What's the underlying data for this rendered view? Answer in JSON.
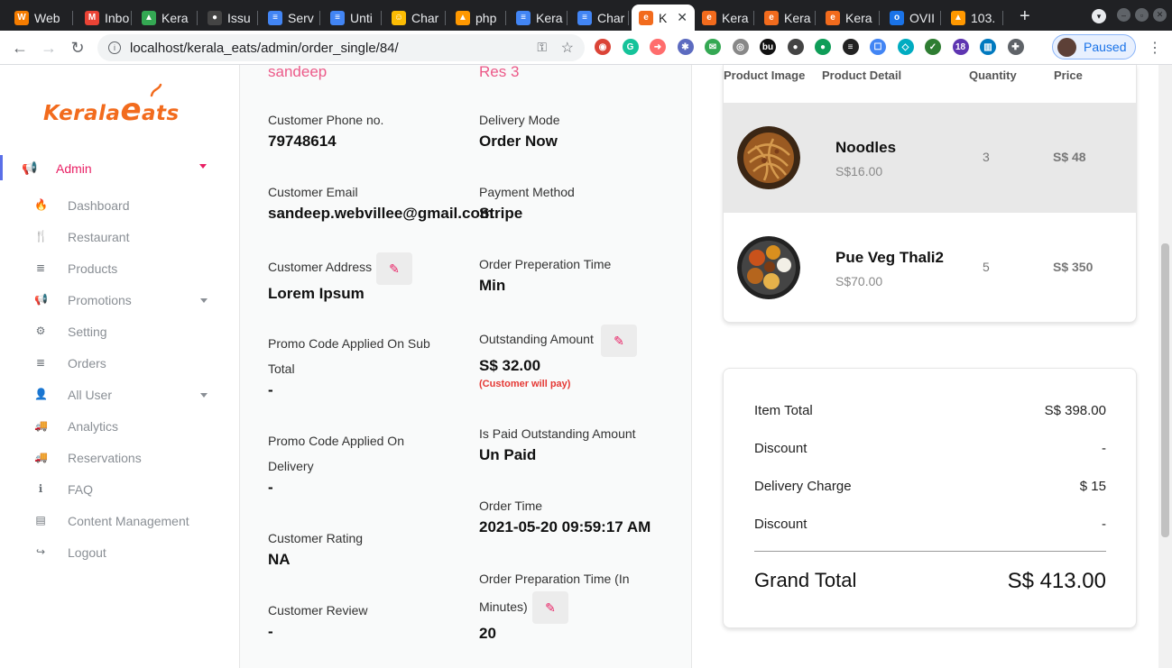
{
  "browser": {
    "tabs": [
      {
        "label": "Web",
        "fav": "W",
        "color": "#f57c00"
      },
      {
        "label": "Inbo",
        "fav": "M",
        "color": "#ea4335"
      },
      {
        "label": "Kera",
        "fav": "▲",
        "color": "#34a853"
      },
      {
        "label": "Issu",
        "fav": "●",
        "color": "#444"
      },
      {
        "label": "Serv",
        "fav": "≡",
        "color": "#4285f4"
      },
      {
        "label": "Unti",
        "fav": "≡",
        "color": "#4285f4"
      },
      {
        "label": "Char",
        "fav": "☺",
        "color": "#fbbc04"
      },
      {
        "label": "php",
        "fav": "▲",
        "color": "#ff9800"
      },
      {
        "label": "Kera",
        "fav": "≡",
        "color": "#4285f4"
      },
      {
        "label": "Char",
        "fav": "≡",
        "color": "#4285f4"
      },
      {
        "label": "K",
        "fav": "e",
        "color": "#f26b1d"
      },
      {
        "label": "Kera",
        "fav": "e",
        "color": "#f26b1d"
      },
      {
        "label": "Kera",
        "fav": "e",
        "color": "#f26b1d"
      },
      {
        "label": "Kera",
        "fav": "e",
        "color": "#f26b1d"
      },
      {
        "label": "OVII",
        "fav": "o",
        "color": "#1a73e8"
      },
      {
        "label": "103.",
        "fav": "▲",
        "color": "#ff9800"
      }
    ],
    "close_glyph": "✕",
    "newtab_glyph": "+",
    "url": "localhost/kerala_eats/admin/order_single/84/",
    "profile_label": "Paused",
    "extensions": [
      {
        "color": "#db4437",
        "glyph": "◉"
      },
      {
        "color": "#15c39a",
        "glyph": "G"
      },
      {
        "color": "#ff6d6d",
        "glyph": "➜"
      },
      {
        "color": "#5c6bc0",
        "glyph": "✱"
      },
      {
        "color": "#34a853",
        "glyph": "✉"
      },
      {
        "color": "#888",
        "glyph": "◎"
      },
      {
        "color": "#111",
        "glyph": "bu"
      },
      {
        "color": "#444",
        "glyph": "●"
      },
      {
        "color": "#0f9d58",
        "glyph": "●"
      },
      {
        "color": "#222",
        "glyph": "≡"
      },
      {
        "color": "#4285f4",
        "glyph": "☐"
      },
      {
        "color": "#00acc1",
        "glyph": "◇"
      },
      {
        "color": "#2e7d32",
        "glyph": "✓"
      },
      {
        "color": "#5e35b1",
        "glyph": "18"
      },
      {
        "color": "#0079bf",
        "glyph": "▥"
      },
      {
        "color": "#5f6368",
        "glyph": "✚"
      }
    ]
  },
  "brand": {
    "logo_text": "Kerala",
    "logo_e": "e",
    "logo_rest": "ats"
  },
  "sidebar": {
    "admin_label": "Admin",
    "items": [
      {
        "label": "Dashboard",
        "icon": "🔥",
        "name": "dashboard"
      },
      {
        "label": "Restaurant",
        "icon": "🍴",
        "name": "restaurant"
      },
      {
        "label": "Products",
        "icon": "≣",
        "name": "products"
      },
      {
        "label": "Promotions",
        "icon": "📢",
        "name": "promotions",
        "caret": true
      },
      {
        "label": "Setting",
        "icon": "⚙",
        "name": "setting"
      },
      {
        "label": "Orders",
        "icon": "≣",
        "name": "orders"
      },
      {
        "label": "All User",
        "icon": "👤",
        "name": "all-user",
        "caret": true
      },
      {
        "label": "Analytics",
        "icon": "🚚",
        "name": "analytics"
      },
      {
        "label": "Reservations",
        "icon": "🚚",
        "name": "reservations"
      },
      {
        "label": "FAQ",
        "icon": "ℹ",
        "name": "faq"
      },
      {
        "label": "Content Management",
        "icon": "▤",
        "name": "content-management"
      },
      {
        "label": "Logout",
        "icon": "↪",
        "name": "logout"
      }
    ]
  },
  "order": {
    "customer_name": "sandeep",
    "restaurant_name": "Res 3",
    "phone_label": "Customer Phone no.",
    "phone": "79748614",
    "delivery_mode_label": "Delivery Mode",
    "delivery_mode": "Order Now",
    "email_label": "Customer Email",
    "email": "sandeep.webvillee@gmail.com",
    "payment_label": "Payment Method",
    "payment": "Stripe",
    "address_label": "Customer Address",
    "address": "Lorem Ipsum",
    "prep_time_label": "Order Preperation Time",
    "prep_time": "Min",
    "promo_sub_label": "Promo Code Applied On Sub Total",
    "promo_sub": "-",
    "outstanding_label": "Outstanding Amount",
    "outstanding": "S$ 32.00",
    "outstanding_note": "(Customer will pay)",
    "promo_delivery_label": "Promo Code Applied On Delivery",
    "promo_delivery": "-",
    "is_paid_label": "Is Paid Outstanding Amount",
    "is_paid": "Un Paid",
    "order_time_label": "Order Time",
    "order_time": "2021-05-20 09:59:17 AM",
    "rating_label": "Customer Rating",
    "rating": "NA",
    "prep_minutes_label": "Order Preparation Time (In Minutes)",
    "prep_minutes": "20",
    "review_label": "Customer Review",
    "review": "-"
  },
  "products": {
    "headers": [
      "Product Image",
      "Product Detail",
      "Quantity",
      "Price"
    ],
    "rows": [
      {
        "name": "Noodles",
        "unit_price": "S$16.00",
        "quantity": "3",
        "total": "S$ 48"
      },
      {
        "name": "Pue Veg Thali2",
        "unit_price": "S$70.00",
        "quantity": "5",
        "total": "S$ 350"
      }
    ]
  },
  "summary": {
    "rows": [
      {
        "label": "Item Total",
        "value": "S$ 398.00"
      },
      {
        "label": "Discount",
        "value": "-"
      },
      {
        "label": "Delivery Charge",
        "value": "$ 15"
      },
      {
        "label": "Discount",
        "value": "-"
      }
    ],
    "grand_label": "Grand Total",
    "grand_value": "S$ 413.00"
  }
}
